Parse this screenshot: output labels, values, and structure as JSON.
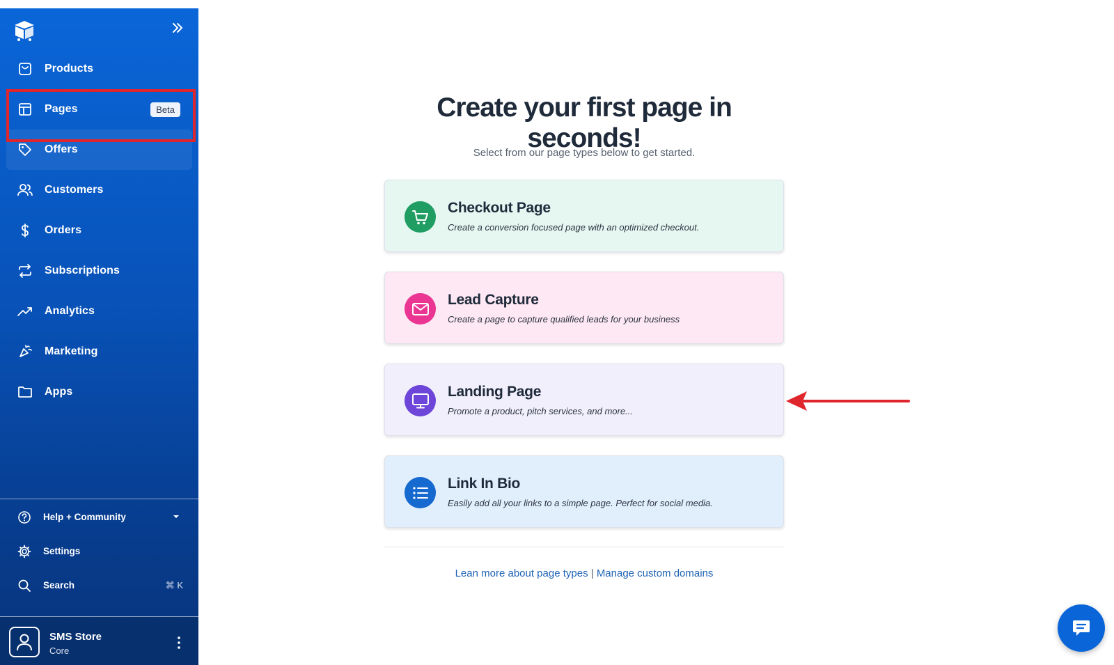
{
  "sidebar": {
    "items": [
      {
        "label": "Products",
        "icon": "shopping-bag-icon"
      },
      {
        "label": "Pages",
        "icon": "layout-icon",
        "badge": "Beta"
      },
      {
        "label": "Offers",
        "icon": "tag-icon"
      },
      {
        "label": "Customers",
        "icon": "users-icon"
      },
      {
        "label": "Orders",
        "icon": "dollar-icon"
      },
      {
        "label": "Subscriptions",
        "icon": "repeat-icon"
      },
      {
        "label": "Analytics",
        "icon": "trending-up-icon"
      },
      {
        "label": "Marketing",
        "icon": "megaphone-icon"
      },
      {
        "label": "Apps",
        "icon": "folder-icon"
      }
    ],
    "bottom": [
      {
        "label": "Help + Community",
        "icon": "help-circle-icon"
      },
      {
        "label": "Settings",
        "icon": "gear-icon"
      },
      {
        "label": "Search",
        "icon": "search-icon",
        "shortcut": "⌘ K"
      }
    ],
    "profile": {
      "name": "SMS Store",
      "plan": "Core"
    }
  },
  "main": {
    "title": "Create your first page in seconds!",
    "subtitle": "Select from our page types below to get started.",
    "cards": [
      {
        "title": "Checkout Page",
        "desc": "Create a conversion focused page with an optimized checkout.",
        "icon": "cart-icon",
        "color": "#1f9d63"
      },
      {
        "title": "Lead Capture",
        "desc": "Create a page to capture qualified leads for your business",
        "icon": "mail-icon",
        "color": "#ea3593"
      },
      {
        "title": "Landing Page",
        "desc": "Promote a product, pitch services, and more...",
        "icon": "monitor-icon",
        "color": "#6d45d9"
      },
      {
        "title": "Link In Bio",
        "desc": "Easily add all your links to a simple page. Perfect for social media.",
        "icon": "list-icon",
        "color": "#1569cf"
      }
    ],
    "links": {
      "learn": "Lean more about page types",
      "separator": " | ",
      "domains": "Manage custom domains"
    }
  },
  "colors": {
    "sidebar": "#0a66d8",
    "highlight": "#e0262d",
    "annotation_arrow": "#e0262d",
    "link": "#1f63b5"
  }
}
